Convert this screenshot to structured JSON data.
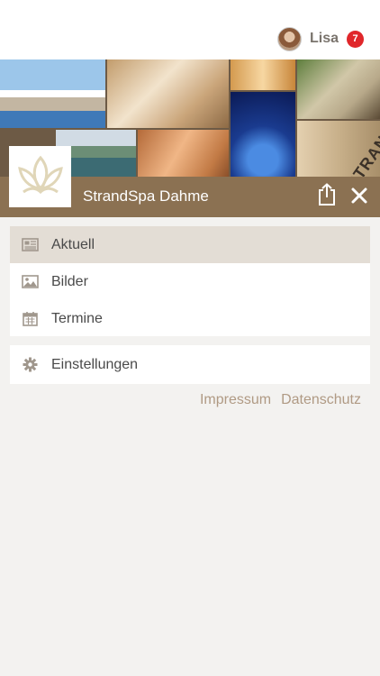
{
  "user": {
    "name": "Lisa",
    "notification_count": "7"
  },
  "app": {
    "title": "StrandSpa Dahme"
  },
  "collage": {
    "watermark": "STRANDSPA"
  },
  "menu": {
    "primary": [
      {
        "label": "Aktuell",
        "icon": "newspaper-icon",
        "active": true
      },
      {
        "label": "Bilder",
        "icon": "image-icon",
        "active": false
      },
      {
        "label": "Termine",
        "icon": "calendar-icon",
        "active": false
      }
    ],
    "secondary": [
      {
        "label": "Einstellungen",
        "icon": "gear-icon",
        "active": false
      }
    ]
  },
  "footer": {
    "impressum": "Impressum",
    "datenschutz": "Datenschutz"
  },
  "colors": {
    "accent": "#8b7152",
    "badge": "#e0262a",
    "active_row": "#e3ddd5",
    "link": "#b09a84"
  }
}
